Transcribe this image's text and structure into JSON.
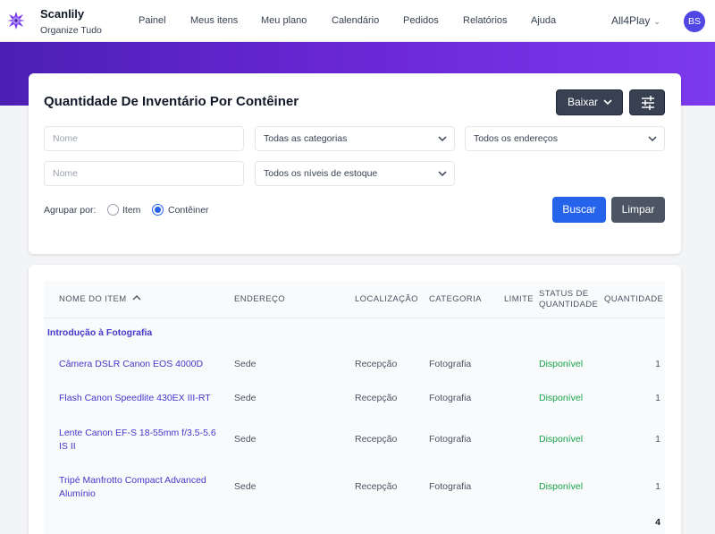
{
  "app": {
    "name": "Scanlily",
    "tagline": "Organize Tudo"
  },
  "nav": [
    "Painel",
    "Meus itens",
    "Meu plano",
    "Calendário",
    "Pedidos",
    "Relatórios",
    "Ajuda"
  ],
  "account": {
    "name": "All4Play",
    "initials": "BS"
  },
  "colors": {
    "accent": "#2563eb",
    "link": "#4338ca",
    "status_available": "#16a34a",
    "banner_start": "#4c1fb5",
    "banner_end": "#7c3aed"
  },
  "report": {
    "title": "Quantidade De Inventário Por Contêiner",
    "export_label": "Baixar",
    "filters": {
      "name_placeholder_1": "Nome",
      "name_placeholder_2": "Nome",
      "category": "Todas as categorias",
      "address": "Todos os endereços",
      "stock_level": "Todos os níveis de estoque"
    },
    "group_by": {
      "label": "Agrupar por:",
      "option_item": "Item",
      "option_container": "Contêiner",
      "selected": "Contêiner"
    },
    "search_label": "Buscar",
    "clear_label": "Limpar"
  },
  "table": {
    "headers": {
      "name": "NOME DO ITEM",
      "address": "ENDEREÇO",
      "location": "LOCALIZAÇÃO",
      "category": "CATEGORIA",
      "limit": "LIMITE",
      "status_1": "STATUS DE",
      "status_2": "QUANTIDADE",
      "quantity": "QUANTIDADE"
    },
    "group": "Introdução à Fotografia",
    "rows": [
      {
        "name_1": "Câmera DSLR Canon EOS 4000D",
        "name_2": "",
        "address": "Sede",
        "location": "Recepção",
        "category": "Fotografia",
        "limit": "",
        "status": "Disponível",
        "quantity": "1"
      },
      {
        "name_1": "Flash Canon Speedlite 430EX III-RT",
        "name_2": "",
        "address": "Sede",
        "location": "Recepção",
        "category": "Fotografia",
        "limit": "",
        "status": "Disponível",
        "quantity": "1"
      },
      {
        "name_1": "Lente Canon EF-S 18-55mm f/3.5-5.6",
        "name_2": "IS II",
        "address": "Sede",
        "location": "Recepção",
        "category": "Fotografia",
        "limit": "",
        "status": "Disponível",
        "quantity": "1"
      },
      {
        "name_1": "Tripé Manfrotto Compact Advanced",
        "name_2": "Alumínio",
        "address": "Sede",
        "location": "Recepção",
        "category": "Fotografia",
        "limit": "",
        "status": "Disponível",
        "quantity": "1"
      }
    ],
    "total": "4"
  }
}
